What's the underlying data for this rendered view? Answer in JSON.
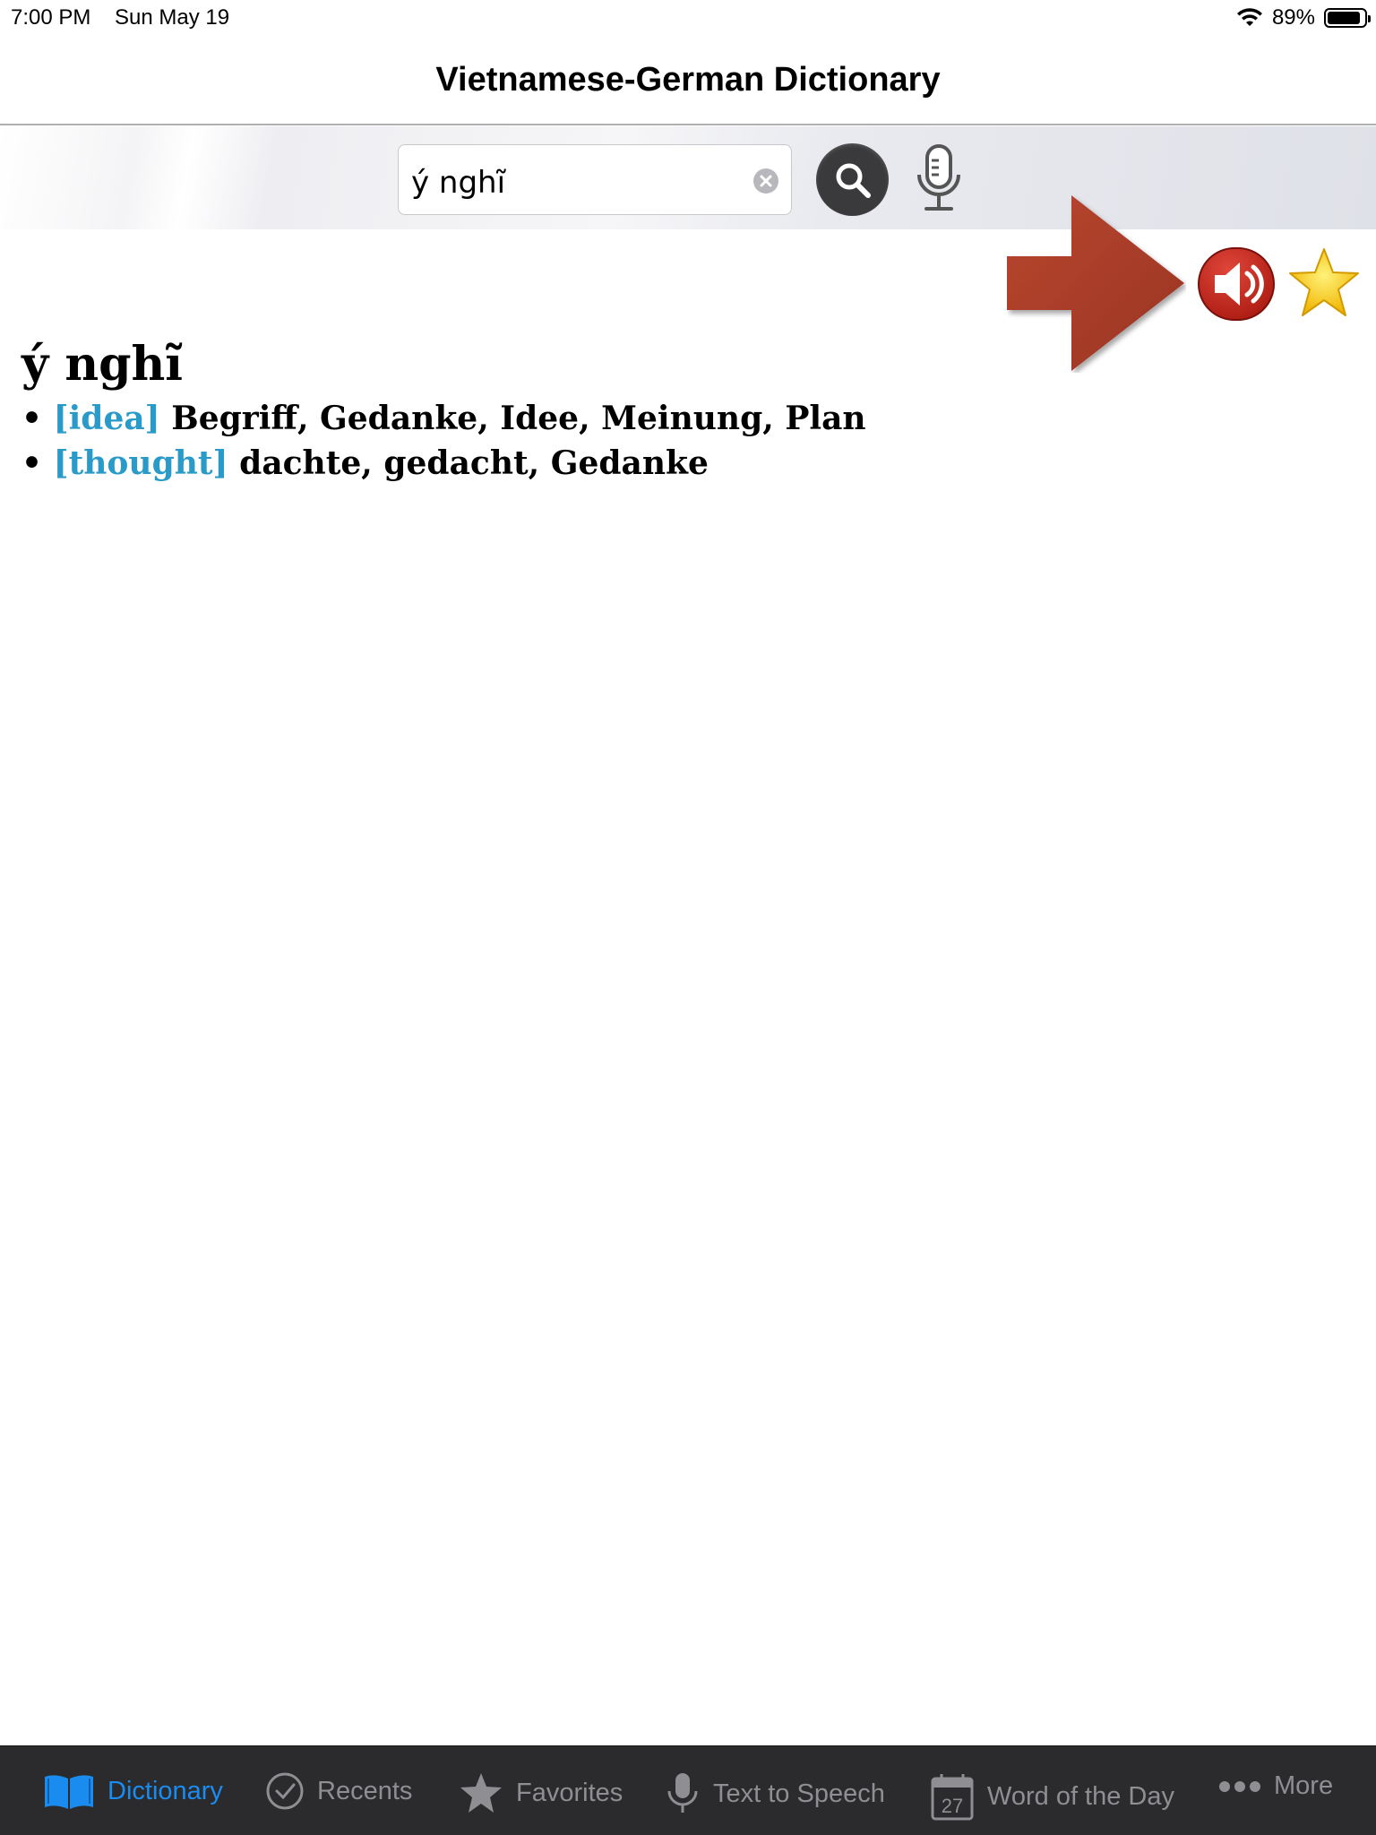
{
  "status_bar": {
    "time": "7:00 PM",
    "date": "Sun May 19",
    "battery_percent": "89%",
    "battery_level": 0.89
  },
  "header": {
    "title": "Vietnamese-German Dictionary"
  },
  "search": {
    "value": "ý nghĩ"
  },
  "icons": {
    "search": "search-icon",
    "microphone": "microphone-icon",
    "speaker": "speaker-icon",
    "favorite": "star-icon",
    "arrow": "arrow-right-icon",
    "colors": {
      "speaker_red": "#c0261d",
      "arrow_red": "#a83a2a",
      "star_gold": "#f5c400",
      "accent_blue": "#1a8cf0",
      "tag_blue": "#2a9ac8"
    }
  },
  "entry": {
    "headword": "ý nghĩ",
    "definitions": [
      {
        "bullet": "•",
        "tag": "[idea]",
        "text": "Begriff, Gedanke, Idee, Meinung, Plan"
      },
      {
        "bullet": "•",
        "tag": "[thought]",
        "text": "dachte, gedacht, Gedanke"
      }
    ]
  },
  "tabs": [
    {
      "label": "Dictionary",
      "icon": "book-icon",
      "active": true
    },
    {
      "label": "Recents",
      "icon": "checkmark-circle-icon",
      "active": false
    },
    {
      "label": "Favorites",
      "icon": "star-icon",
      "active": false
    },
    {
      "label": "Text to Speech",
      "icon": "microphone-icon",
      "active": false
    },
    {
      "label": "Word of the Day",
      "icon": "calendar-icon",
      "icon_text": "27",
      "active": false
    },
    {
      "label": "More",
      "icon": "more-dots-icon",
      "active": false
    }
  ]
}
